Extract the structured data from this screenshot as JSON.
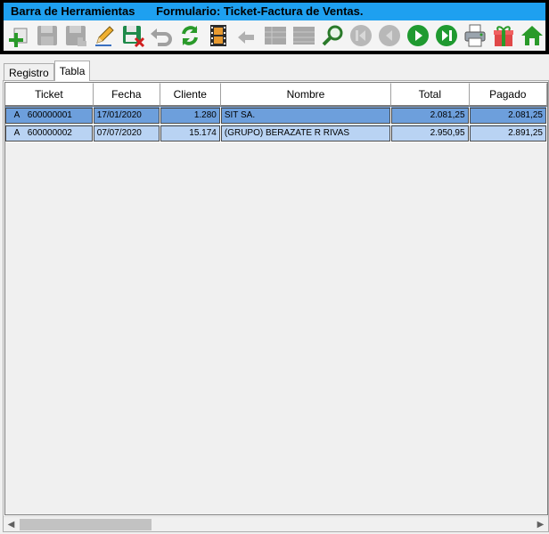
{
  "titlebar": {
    "left": "Barra de Herramientas",
    "right": "Formulario: Ticket-Factura de Ventas."
  },
  "toolbar": {
    "icons": [
      "add-icon",
      "save-disabled-icon",
      "save-as-disabled-icon",
      "edit-icon",
      "save-cancel-icon",
      "undo-disabled-icon",
      "refresh-icon",
      "film-icon",
      "back-arrow-disabled-icon",
      "grid-disabled-icon",
      "grid2-disabled-icon",
      "search-icon",
      "first-record-disabled-icon",
      "prev-record-disabled-icon",
      "next-record-icon",
      "last-record-icon",
      "print-icon",
      "gift-icon",
      "home-icon"
    ]
  },
  "tabs": [
    {
      "label": "Registro",
      "active": false
    },
    {
      "label": "Tabla",
      "active": true
    }
  ],
  "table": {
    "columns": [
      "Ticket",
      "Fecha",
      "Cliente",
      "Nombre",
      "Total",
      "Pagado"
    ],
    "rows": [
      {
        "serie": "A",
        "ticket": "600000001",
        "fecha": "17/01/2020",
        "cliente": "1.280",
        "nombre": "SIT SA.",
        "total": "2.081,25",
        "pagado": "2.081,25"
      },
      {
        "serie": "A",
        "ticket": "600000002",
        "fecha": "07/07/2020",
        "cliente": "15.174",
        "nombre": "(GRUPO) BERAZATE R RIVAS",
        "total": "2.950,95",
        "pagado": "2.891,25"
      }
    ]
  },
  "colors": {
    "title_bg": "#1ea0f0",
    "row_selected": "#6d9fdc",
    "row_alt": "#b9d3f3"
  }
}
